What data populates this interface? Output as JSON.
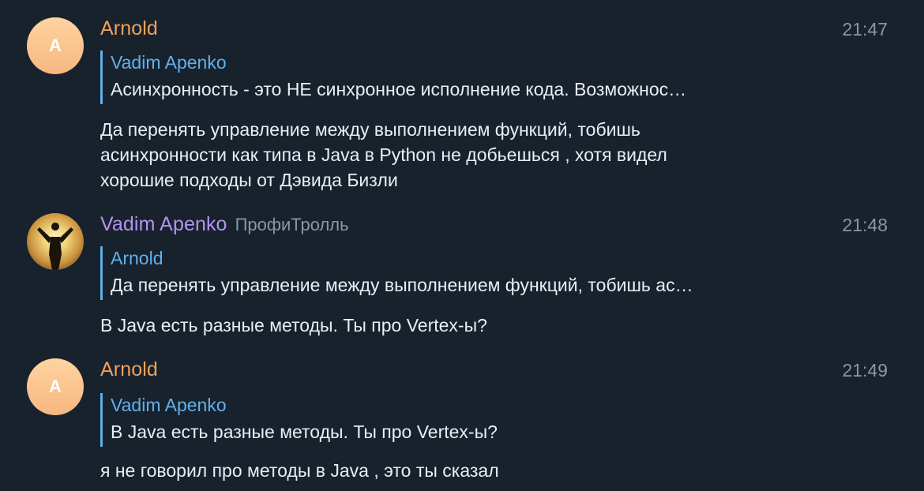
{
  "messages": [
    {
      "avatar_letter": "A",
      "sender": "Arnold",
      "sender_title": "",
      "time": "21:47",
      "reply_to": {
        "name": "Vadim Apenko",
        "text": "Асинхронность - это НЕ синхронное исполнение кода. Возможнос…"
      },
      "body_lines": [
        "Да перенять управление между выполнением функций, тобишь",
        "асинхронности как типа в Java в Python не добьешься , хотя видел",
        "хорошие подходы от Дэвида Бизли"
      ]
    },
    {
      "avatar_letter": "",
      "sender": "Vadim Apenko",
      "sender_title": "ПрофиТролль",
      "time": "21:48",
      "reply_to": {
        "name": "Arnold",
        "text": "Да перенять управление между выполнением функций, тобишь ас…"
      },
      "body_lines": [
        "В Java есть разные методы. Ты про Vertex-ы?"
      ]
    },
    {
      "avatar_letter": "A",
      "sender": "Arnold",
      "sender_title": "",
      "time": "21:49",
      "reply_to": {
        "name": "Vadim Apenko",
        "text": "В Java есть разные методы. Ты про Vertex-ы?"
      },
      "body_lines": [
        "я не говорил про методы в Java , это ты сказал"
      ]
    }
  ],
  "colors": {
    "background": "#18222d",
    "sender_orange": "#f0a25e",
    "sender_purple": "#b592f0",
    "reply_accent": "#62b0ec",
    "muted": "#8a96a3",
    "text": "#e9eef3"
  },
  "icons": {
    "avatar_photo": "person-silhouette-sunset-avatar"
  }
}
